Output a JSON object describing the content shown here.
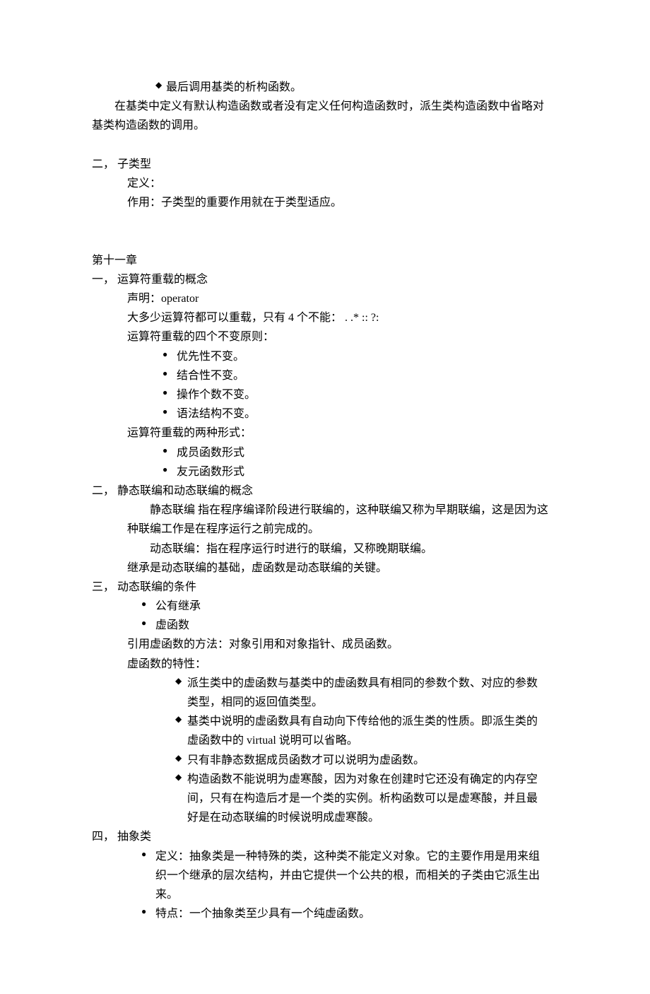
{
  "top": {
    "d1": "最后调用基类的析构函数。",
    "p1a": "在基类中定义有默认构造函数或者没有定义任何构造函数时，派生类构造函数中省略对",
    "p1b": "基类构造函数的调用。"
  },
  "sec2": {
    "title": "二，  子类型",
    "line1": "定义：",
    "line2": "作用：子类型的重要作用就在于类型适应。"
  },
  "ch11": {
    "title": "第十一章",
    "s1": {
      "title": "一，  运算符重载的概念",
      "l1": "声明：operator",
      "l2": "大多少运算符都可以重载，只有 4 个不能：  . .* :: ?:",
      "l3": "运算符重载的四个不变原则：",
      "b1": "优先性不变。",
      "b2": "结合性不变。",
      "b3": "操作个数不变。",
      "b4": "语法结构不变。",
      "l4": "运算符重载的两种形式：",
      "b5": "成员函数形式",
      "b6": "友元函数形式"
    },
    "s2": {
      "title": "二，  静态联编和动态联编的概念",
      "p1a": "静态联编  指在程序编译阶段进行联编的，这种联编又称为早期联编，这是因为这",
      "p1b": "种联编工作是在程序运行之前完成的。",
      "p2": "动态联编：指在程序运行时进行的联编，又称晚期联编。",
      "p3": "继承是动态联编的基础，虚函数是动态联编的关键。"
    },
    "s3": {
      "title": "三，  动态联编的条件",
      "b1": "公有继承",
      "b2": "虚函数",
      "l1": "引用虚函数的方法：对象引用和对象指针、成员函数。",
      "l2": "虚函数的特性：",
      "d1a": "派生类中的虚函数与基类中的虚函数具有相同的参数个数、对应的参数",
      "d1b": "类型，相同的返回值类型。",
      "d2a": "基类中说明的虚函数具有自动向下传给他的派生类的性质。即派生类的",
      "d2b": "虚函数中的 virtual 说明可以省略。",
      "d3": "只有非静态数据成员函数才可以说明为虚函数。",
      "d4a": "构造函数不能说明为虚寒酸，因为对象在创建时它还没有确定的内存空",
      "d4b": "间，只有在构造后才是一个类的实例。析构函数可以是虚寒酸，并且最",
      "d4c": "好是在动态联编的时候说明成虚寒酸。"
    },
    "s4": {
      "title": "四，  抽象类",
      "b1a": "定义：抽象类是一种特殊的类，这种类不能定义对象。它的主要作用是用来组",
      "b1b": "织一个继承的层次结构，并由它提供一个公共的根，而相关的子类由它派生出",
      "b1c": "来。",
      "b2": "特点：一个抽象类至少具有一个纯虚函数。"
    }
  }
}
